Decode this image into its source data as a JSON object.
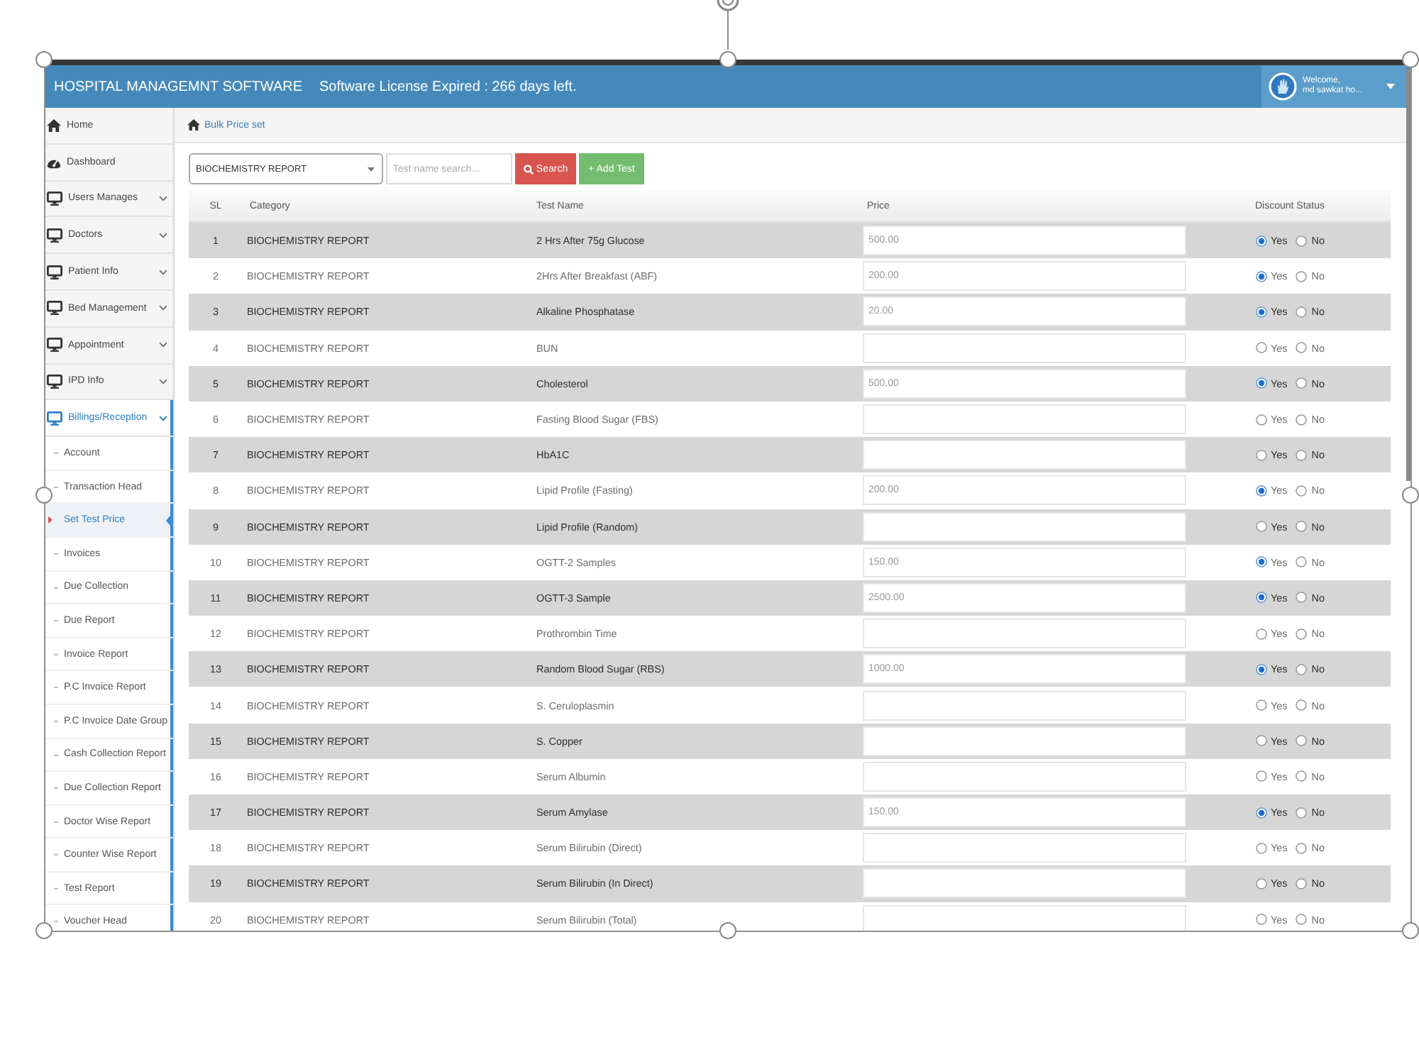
{
  "header": {
    "title": "HOSPITAL MANAGEMNT SOFTWARE",
    "license_notice": "Software License Expired : 266 days left.",
    "user": {
      "greeting": "Welcome,",
      "name": "md sawkat ho..."
    }
  },
  "sidebar": {
    "items": [
      {
        "label": "Home",
        "selected": false
      },
      {
        "label": "Dashboard",
        "selected": false
      },
      {
        "label": "Users Manages",
        "selected": false,
        "expanded": false
      },
      {
        "label": "Doctors",
        "selected": false,
        "expanded": false
      },
      {
        "label": "Patient Info",
        "selected": false,
        "expanded": false
      },
      {
        "label": "Bed Management",
        "selected": false,
        "expanded": false
      },
      {
        "label": "Appointment",
        "selected": false,
        "expanded": false
      },
      {
        "label": "IPD Info",
        "selected": false,
        "expanded": false
      },
      {
        "label": "Billings/Reception",
        "selected": false,
        "expanded": true,
        "children": [
          {
            "label": "Account",
            "selected": false
          },
          {
            "label": "Transaction Head",
            "selected": false
          },
          {
            "label": "Set Test Price",
            "selected": true
          },
          {
            "label": "Invoices",
            "selected": false
          },
          {
            "label": "Due Collection",
            "selected": false
          },
          {
            "label": "Due Report",
            "selected": false
          },
          {
            "label": "Invoice Report",
            "selected": false
          },
          {
            "label": "P.C Invoice Report",
            "selected": false
          },
          {
            "label": "P.C Invoice Date Group",
            "selected": false
          },
          {
            "label": "Cash Collection Report",
            "selected": false
          },
          {
            "label": "Due Collection Report",
            "selected": false
          },
          {
            "label": "Doctor Wise Report",
            "selected": false
          },
          {
            "label": "Counter Wise Report",
            "selected": false
          },
          {
            "label": "Test Report",
            "selected": false
          },
          {
            "label": "Voucher Head",
            "selected": false
          }
        ]
      }
    ]
  },
  "breadcrumb": {
    "label": "Bulk Price set"
  },
  "toolbar": {
    "category_select": {
      "value": "BIOCHEMISTRY REPORT"
    },
    "search": {
      "placeholder": "Test name search..."
    },
    "buttons": [
      {
        "label": "Search",
        "kind": "search"
      },
      {
        "label": "+ Add Test",
        "kind": "add"
      }
    ]
  },
  "table": {
    "columns": [
      "SL",
      "Category",
      "Test Name",
      "Price",
      "Discount Status"
    ],
    "rows": [
      {
        "sl": "1",
        "category": "BIOCHEMISTRY REPORT",
        "test_name": "2 Hrs After 75g Glucose",
        "price": "500.00",
        "discount": [
          {
            "label": "Yes",
            "selected": true
          },
          {
            "label": "No",
            "selected": false
          }
        ]
      },
      {
        "sl": "2",
        "category": "BIOCHEMISTRY REPORT",
        "test_name": "2Hrs After Breakfast (ABF)",
        "price": "200.00",
        "discount": [
          {
            "label": "Yes",
            "selected": true
          },
          {
            "label": "No",
            "selected": false
          }
        ]
      },
      {
        "sl": "3",
        "category": "BIOCHEMISTRY REPORT",
        "test_name": "Alkaline Phosphatase",
        "price": "20.00",
        "discount": [
          {
            "label": "Yes",
            "selected": true
          },
          {
            "label": "No",
            "selected": false
          }
        ]
      },
      {
        "sl": "4",
        "category": "BIOCHEMISTRY REPORT",
        "test_name": "BUN",
        "discount": [
          {
            "label": "Yes",
            "selected": false
          },
          {
            "label": "No",
            "selected": false
          }
        ]
      },
      {
        "sl": "5",
        "category": "BIOCHEMISTRY REPORT",
        "test_name": "Cholesterol",
        "price": "500.00",
        "discount": [
          {
            "label": "Yes",
            "selected": true
          },
          {
            "label": "No",
            "selected": false
          }
        ]
      },
      {
        "sl": "6",
        "category": "BIOCHEMISTRY REPORT",
        "test_name": "Fasting Blood Sugar (FBS)",
        "discount": [
          {
            "label": "Yes",
            "selected": false
          },
          {
            "label": "No",
            "selected": false
          }
        ]
      },
      {
        "sl": "7",
        "category": "BIOCHEMISTRY REPORT",
        "test_name": "HbA1C",
        "discount": [
          {
            "label": "Yes",
            "selected": false
          },
          {
            "label": "No",
            "selected": false
          }
        ]
      },
      {
        "sl": "8",
        "category": "BIOCHEMISTRY REPORT",
        "test_name": "Lipid Profile (Fasting)",
        "price": "200.00",
        "discount": [
          {
            "label": "Yes",
            "selected": true
          },
          {
            "label": "No",
            "selected": false
          }
        ]
      },
      {
        "sl": "9",
        "category": "BIOCHEMISTRY REPORT",
        "test_name": "Lipid Profile (Random)",
        "discount": [
          {
            "label": "Yes",
            "selected": false
          },
          {
            "label": "No",
            "selected": false
          }
        ]
      },
      {
        "sl": "10",
        "category": "BIOCHEMISTRY REPORT",
        "test_name": "OGTT-2 Samples",
        "price": "150.00",
        "discount": [
          {
            "label": "Yes",
            "selected": true
          },
          {
            "label": "No",
            "selected": false
          }
        ]
      },
      {
        "sl": "11",
        "category": "BIOCHEMISTRY REPORT",
        "test_name": "OGTT-3 Sample",
        "price": "2500.00",
        "discount": [
          {
            "label": "Yes",
            "selected": true
          },
          {
            "label": "No",
            "selected": false
          }
        ]
      },
      {
        "sl": "12",
        "category": "BIOCHEMISTRY REPORT",
        "test_name": "Prothrombin Time",
        "discount": [
          {
            "label": "Yes",
            "selected": false
          },
          {
            "label": "No",
            "selected": false
          }
        ]
      },
      {
        "sl": "13",
        "category": "BIOCHEMISTRY REPORT",
        "test_name": "Random Blood Sugar (RBS)",
        "price": "1000.00",
        "discount": [
          {
            "label": "Yes",
            "selected": true
          },
          {
            "label": "No",
            "selected": false
          }
        ]
      },
      {
        "sl": "14",
        "category": "BIOCHEMISTRY REPORT",
        "test_name": "S. Ceruloplasmin",
        "discount": [
          {
            "label": "Yes",
            "selected": false
          },
          {
            "label": "No",
            "selected": false
          }
        ]
      },
      {
        "sl": "15",
        "category": "BIOCHEMISTRY REPORT",
        "test_name": "S. Copper",
        "discount": [
          {
            "label": "Yes",
            "selected": false
          },
          {
            "label": "No",
            "selected": false
          }
        ]
      },
      {
        "sl": "16",
        "category": "BIOCHEMISTRY REPORT",
        "test_name": "Serum Albumin",
        "discount": [
          {
            "label": "Yes",
            "selected": false
          },
          {
            "label": "No",
            "selected": false
          }
        ]
      },
      {
        "sl": "17",
        "category": "BIOCHEMISTRY REPORT",
        "test_name": "Serum Amylase",
        "price": "150.00",
        "discount": [
          {
            "label": "Yes",
            "selected": true
          },
          {
            "label": "No",
            "selected": false
          }
        ]
      },
      {
        "sl": "18",
        "category": "BIOCHEMISTRY REPORT",
        "test_name": "Serum Bilirubin (Direct)",
        "discount": [
          {
            "label": "Yes",
            "selected": false
          },
          {
            "label": "No",
            "selected": false
          }
        ]
      },
      {
        "sl": "19",
        "category": "BIOCHEMISTRY REPORT",
        "test_name": "Serum Bilirubin (In Direct)",
        "discount": [
          {
            "label": "Yes",
            "selected": false
          },
          {
            "label": "No",
            "selected": false
          }
        ]
      },
      {
        "sl": "20",
        "category": "BIOCHEMISTRY REPORT",
        "test_name": "Serum Bilirubin (Total)",
        "discount": [
          {
            "label": "Yes",
            "selected": false
          },
          {
            "label": "No",
            "selected": false
          }
        ]
      }
    ]
  }
}
